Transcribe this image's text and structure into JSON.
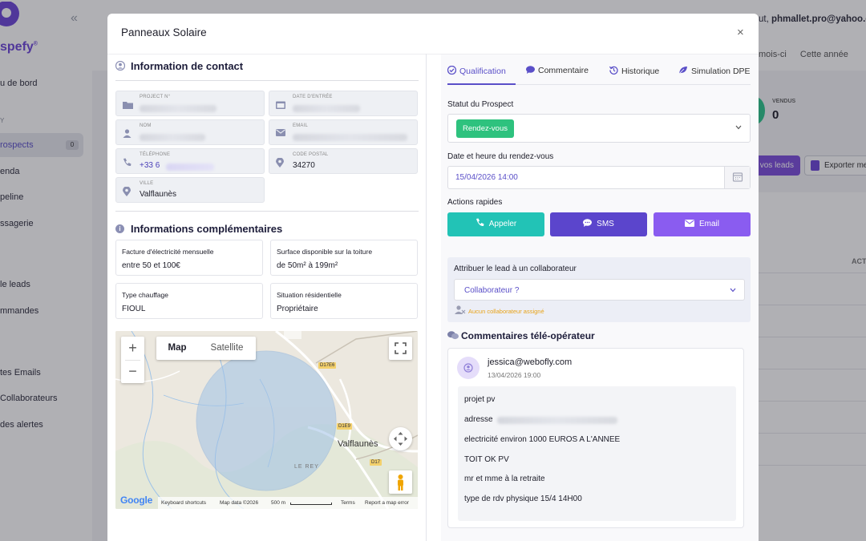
{
  "background": {
    "brand": "spefy",
    "brand_mark": "®",
    "nav": [
      {
        "label": "u de bord"
      },
      {
        "label": "Y"
      },
      {
        "label": "rospects",
        "badge": "0"
      },
      {
        "label": "enda"
      },
      {
        "label": "peline"
      },
      {
        "label": "ssagerie"
      },
      {
        "label": "le leads"
      },
      {
        "label": "mmandes"
      },
      {
        "label": "tes Emails"
      },
      {
        "label": "Collaborateurs"
      },
      {
        "label": "des alertes"
      }
    ],
    "user_prefix": "ut,",
    "user_email": "phmallet.pro@yahoo.co",
    "period_tabs": [
      "mois-ci",
      "Cette année"
    ],
    "stat_label": "VENDUS",
    "stat_value": "0",
    "leads_button": "vos leads",
    "export_button": "Exporter me",
    "table_header": "ACT"
  },
  "modal": {
    "title": "Panneaux Solaire",
    "close": "×",
    "contact": {
      "title": "Information de contact",
      "fields": {
        "project_label": "PROJECT N°",
        "date_label": "DATE D'ENTRÉE",
        "name_label": "NOM",
        "email_label": "EMAIL",
        "phone_label": "TÉLÉPHONE",
        "phone_value": "+33 6",
        "postal_label": "CODE POSTAL",
        "postal_value": "34270",
        "city_label": "VILLE",
        "city_value": "Valflaunès"
      }
    },
    "extra": {
      "title": "Informations complémentaires",
      "items": [
        {
          "label": "Facture d'électricité mensuelle",
          "value": "entre 50 et 100€"
        },
        {
          "label": "Surface disponible sur la toiture",
          "value": "de 50m² à 199m²"
        },
        {
          "label": "Type chauffage",
          "value": "FIOUL"
        },
        {
          "label": "Situation résidentielle",
          "value": "Propriétaire"
        }
      ]
    },
    "map": {
      "type_map": "Map",
      "type_satellite": "Satellite",
      "zoom_in": "+",
      "zoom_out": "−",
      "place": "Valflaunès",
      "place_small": "LE REY",
      "roads": [
        "D17E6",
        "D1E9",
        "D17"
      ],
      "google": "Google",
      "footer": [
        "Keyboard shortcuts",
        "Map data ©2026",
        "500 m",
        "Terms",
        "Report a map error"
      ]
    },
    "tabs": [
      "Qualification",
      "Commentaire",
      "Historique",
      "Simulation DPE"
    ],
    "status": {
      "label": "Statut du Prospect",
      "value": "Rendez-vous"
    },
    "rdv": {
      "label": "Date et heure du rendez-vous",
      "value": "15/04/2026 14:00"
    },
    "actions": {
      "label": "Actions rapides",
      "call": "Appeler",
      "sms": "SMS",
      "email": "Email"
    },
    "assign": {
      "label": "Attribuer le lead à un collaborateur",
      "placeholder": "Collaborateur ?",
      "note": "Aucun collaborateur assigné"
    },
    "comments": {
      "title": "Commentaires télé-opérateur",
      "author": "jessica@webofly.com",
      "date": "13/04/2026 19:00",
      "lines": [
        "projet pv",
        "adresse",
        "electricité environ 1000 EUROS A L'ANNEE",
        "TOIT OK PV",
        "mr et mme à la retraite",
        "type de rdv physique 15/4 14H00"
      ]
    }
  },
  "colors": {
    "accent": "#5a4fc8",
    "teal": "#22c3b6",
    "indigo": "#5b45cc",
    "violet": "#8a5cf0",
    "success": "#2ec27e"
  }
}
